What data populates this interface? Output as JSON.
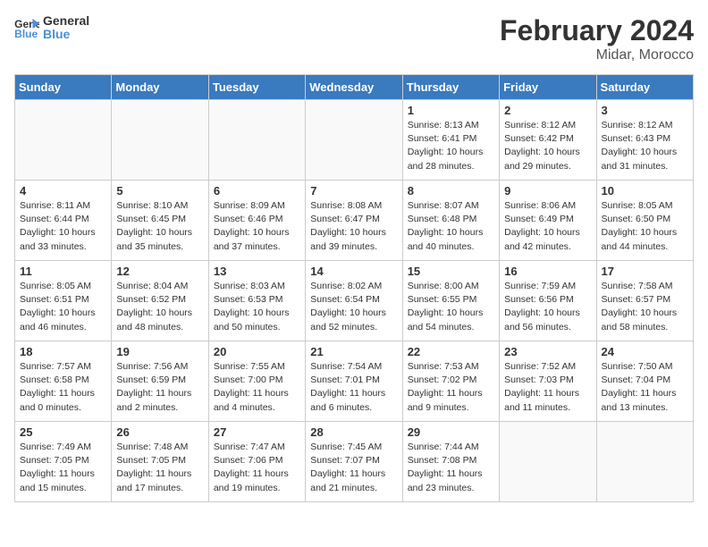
{
  "header": {
    "logo_line1": "General",
    "logo_line2": "Blue",
    "title": "February 2024",
    "subtitle": "Midar, Morocco"
  },
  "days_of_week": [
    "Sunday",
    "Monday",
    "Tuesday",
    "Wednesday",
    "Thursday",
    "Friday",
    "Saturday"
  ],
  "weeks": [
    [
      {
        "num": "",
        "info": ""
      },
      {
        "num": "",
        "info": ""
      },
      {
        "num": "",
        "info": ""
      },
      {
        "num": "",
        "info": ""
      },
      {
        "num": "1",
        "info": "Sunrise: 8:13 AM\nSunset: 6:41 PM\nDaylight: 10 hours\nand 28 minutes."
      },
      {
        "num": "2",
        "info": "Sunrise: 8:12 AM\nSunset: 6:42 PM\nDaylight: 10 hours\nand 29 minutes."
      },
      {
        "num": "3",
        "info": "Sunrise: 8:12 AM\nSunset: 6:43 PM\nDaylight: 10 hours\nand 31 minutes."
      }
    ],
    [
      {
        "num": "4",
        "info": "Sunrise: 8:11 AM\nSunset: 6:44 PM\nDaylight: 10 hours\nand 33 minutes."
      },
      {
        "num": "5",
        "info": "Sunrise: 8:10 AM\nSunset: 6:45 PM\nDaylight: 10 hours\nand 35 minutes."
      },
      {
        "num": "6",
        "info": "Sunrise: 8:09 AM\nSunset: 6:46 PM\nDaylight: 10 hours\nand 37 minutes."
      },
      {
        "num": "7",
        "info": "Sunrise: 8:08 AM\nSunset: 6:47 PM\nDaylight: 10 hours\nand 39 minutes."
      },
      {
        "num": "8",
        "info": "Sunrise: 8:07 AM\nSunset: 6:48 PM\nDaylight: 10 hours\nand 40 minutes."
      },
      {
        "num": "9",
        "info": "Sunrise: 8:06 AM\nSunset: 6:49 PM\nDaylight: 10 hours\nand 42 minutes."
      },
      {
        "num": "10",
        "info": "Sunrise: 8:05 AM\nSunset: 6:50 PM\nDaylight: 10 hours\nand 44 minutes."
      }
    ],
    [
      {
        "num": "11",
        "info": "Sunrise: 8:05 AM\nSunset: 6:51 PM\nDaylight: 10 hours\nand 46 minutes."
      },
      {
        "num": "12",
        "info": "Sunrise: 8:04 AM\nSunset: 6:52 PM\nDaylight: 10 hours\nand 48 minutes."
      },
      {
        "num": "13",
        "info": "Sunrise: 8:03 AM\nSunset: 6:53 PM\nDaylight: 10 hours\nand 50 minutes."
      },
      {
        "num": "14",
        "info": "Sunrise: 8:02 AM\nSunset: 6:54 PM\nDaylight: 10 hours\nand 52 minutes."
      },
      {
        "num": "15",
        "info": "Sunrise: 8:00 AM\nSunset: 6:55 PM\nDaylight: 10 hours\nand 54 minutes."
      },
      {
        "num": "16",
        "info": "Sunrise: 7:59 AM\nSunset: 6:56 PM\nDaylight: 10 hours\nand 56 minutes."
      },
      {
        "num": "17",
        "info": "Sunrise: 7:58 AM\nSunset: 6:57 PM\nDaylight: 10 hours\nand 58 minutes."
      }
    ],
    [
      {
        "num": "18",
        "info": "Sunrise: 7:57 AM\nSunset: 6:58 PM\nDaylight: 11 hours\nand 0 minutes."
      },
      {
        "num": "19",
        "info": "Sunrise: 7:56 AM\nSunset: 6:59 PM\nDaylight: 11 hours\nand 2 minutes."
      },
      {
        "num": "20",
        "info": "Sunrise: 7:55 AM\nSunset: 7:00 PM\nDaylight: 11 hours\nand 4 minutes."
      },
      {
        "num": "21",
        "info": "Sunrise: 7:54 AM\nSunset: 7:01 PM\nDaylight: 11 hours\nand 6 minutes."
      },
      {
        "num": "22",
        "info": "Sunrise: 7:53 AM\nSunset: 7:02 PM\nDaylight: 11 hours\nand 9 minutes."
      },
      {
        "num": "23",
        "info": "Sunrise: 7:52 AM\nSunset: 7:03 PM\nDaylight: 11 hours\nand 11 minutes."
      },
      {
        "num": "24",
        "info": "Sunrise: 7:50 AM\nSunset: 7:04 PM\nDaylight: 11 hours\nand 13 minutes."
      }
    ],
    [
      {
        "num": "25",
        "info": "Sunrise: 7:49 AM\nSunset: 7:05 PM\nDaylight: 11 hours\nand 15 minutes."
      },
      {
        "num": "26",
        "info": "Sunrise: 7:48 AM\nSunset: 7:05 PM\nDaylight: 11 hours\nand 17 minutes."
      },
      {
        "num": "27",
        "info": "Sunrise: 7:47 AM\nSunset: 7:06 PM\nDaylight: 11 hours\nand 19 minutes."
      },
      {
        "num": "28",
        "info": "Sunrise: 7:45 AM\nSunset: 7:07 PM\nDaylight: 11 hours\nand 21 minutes."
      },
      {
        "num": "29",
        "info": "Sunrise: 7:44 AM\nSunset: 7:08 PM\nDaylight: 11 hours\nand 23 minutes."
      },
      {
        "num": "",
        "info": ""
      },
      {
        "num": "",
        "info": ""
      }
    ]
  ]
}
